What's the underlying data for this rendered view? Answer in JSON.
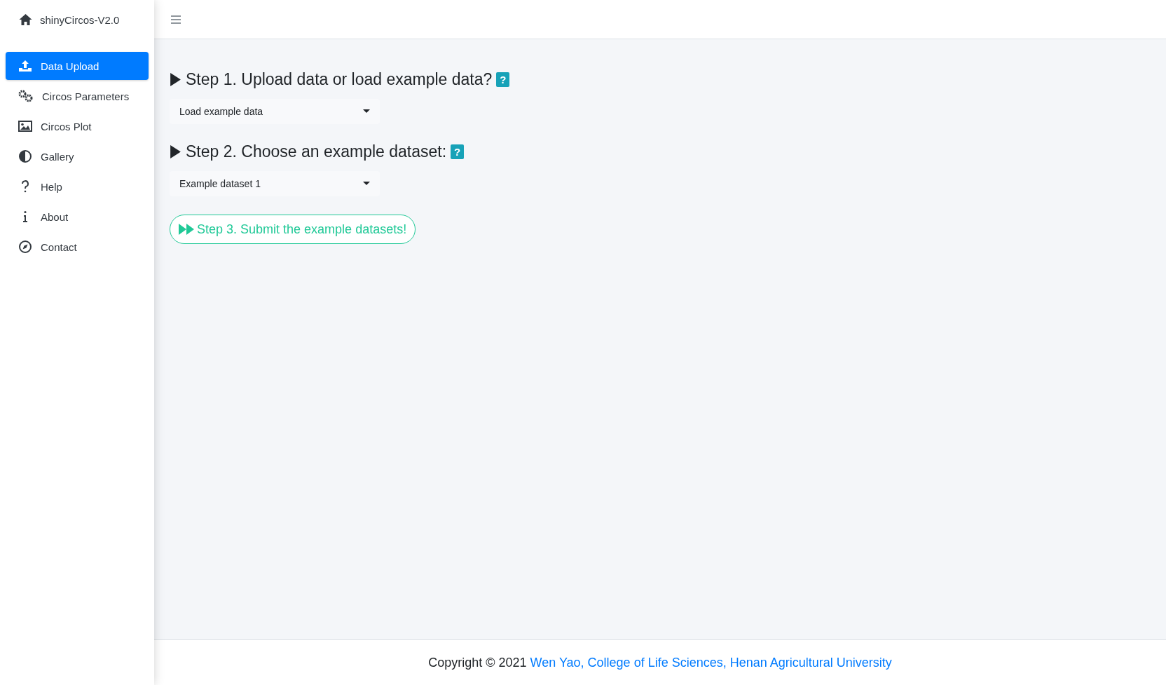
{
  "sidebar": {
    "brand": "shinyCircos-V2.0",
    "items": [
      {
        "label": "Data Upload",
        "selected": true
      },
      {
        "label": "Circos Parameters",
        "selected": false
      },
      {
        "label": "Circos Plot",
        "selected": false
      },
      {
        "label": "Gallery",
        "selected": false
      },
      {
        "label": "Help",
        "selected": false
      },
      {
        "label": "About",
        "selected": false
      },
      {
        "label": "Contact",
        "selected": false
      }
    ]
  },
  "steps": [
    {
      "heading": "Step 1. Upload data or load example data?",
      "help": "?",
      "select": "Load example data"
    },
    {
      "heading": "Step 2. Choose an example dataset:",
      "help": "?",
      "select": "Example dataset 1"
    }
  ],
  "submit_button": "Step 3. Submit the example datasets!",
  "footer": {
    "text": "Copyright © 2021",
    "link": "Wen Yao, College of Life Sciences, Henan Agricultural University"
  }
}
